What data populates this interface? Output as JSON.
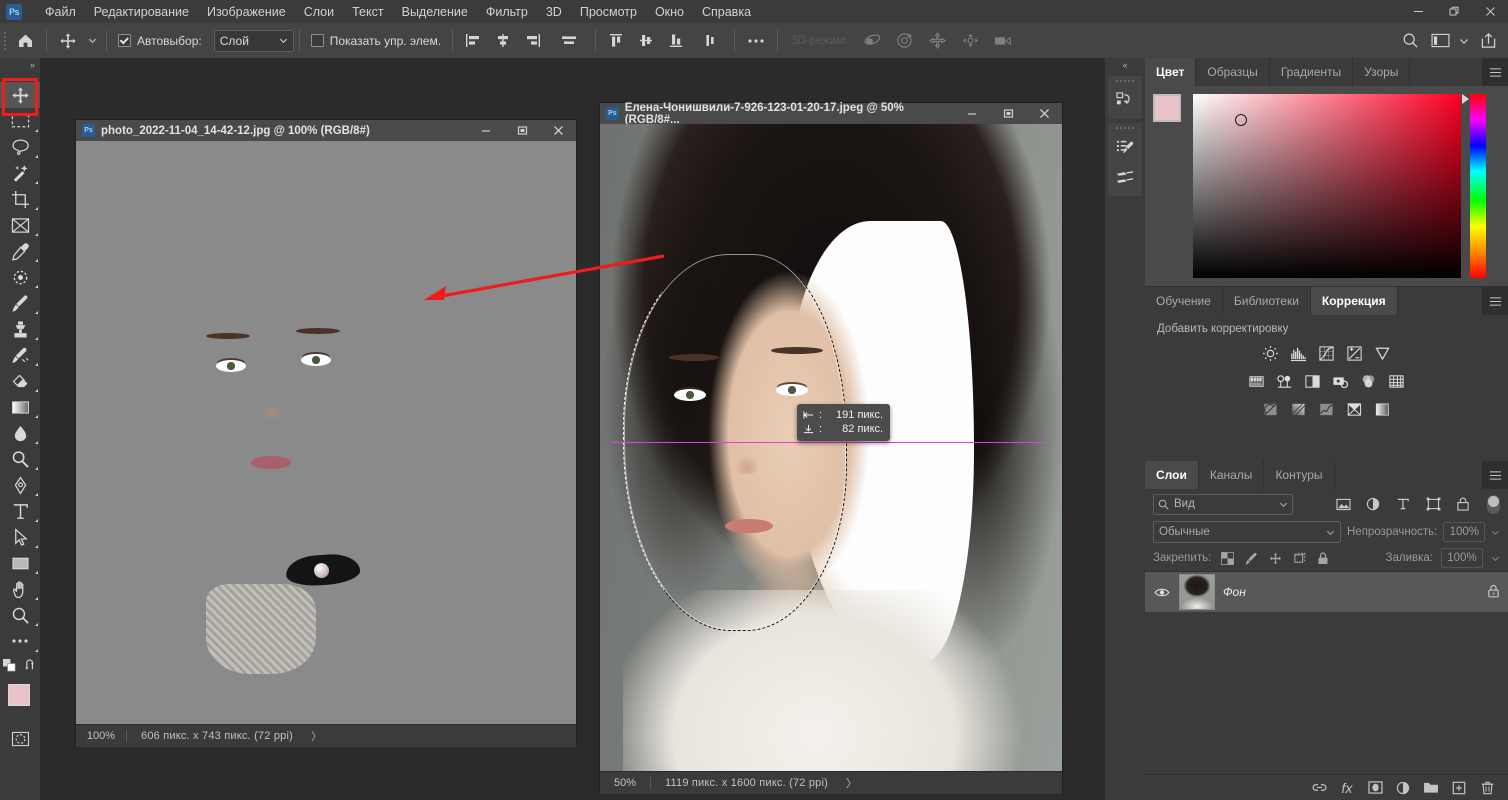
{
  "app": {
    "name": "Adobe Photoshop",
    "logo_text": "Ps",
    "window_controls": {
      "minimize": "minimize-icon",
      "restore": "restore-icon",
      "close": "close-icon"
    }
  },
  "menu": {
    "items": [
      {
        "label": "Файл"
      },
      {
        "label": "Редактирование"
      },
      {
        "label": "Изображение"
      },
      {
        "label": "Слои"
      },
      {
        "label": "Текст"
      },
      {
        "label": "Выделение"
      },
      {
        "label": "Фильтр"
      },
      {
        "label": "3D"
      },
      {
        "label": "Просмотр"
      },
      {
        "label": "Окно"
      },
      {
        "label": "Справка"
      }
    ]
  },
  "options_bar": {
    "home_icon": "home-icon",
    "tool_icon": "move-tool-icon",
    "autoselect_label": "Автовыбор:",
    "autoselect_checked": true,
    "autoselect_value": "Слой",
    "show_controls_label": "Показать упр. элем.",
    "show_controls_checked": false,
    "mode3d_label": "3D-режим:",
    "align_icons": [
      "align-left-icon",
      "align-center-horizontal-icon",
      "align-right-icon",
      "distribute-horizontal-icon"
    ],
    "align_icons2": [
      "align-top-icon",
      "align-middle-vertical-icon",
      "align-bottom-icon",
      "distribute-vertical-icon"
    ],
    "more_icon": "more-options-icon",
    "mode3d_icons": [
      "orbit-3d-icon",
      "roll-3d-icon",
      "pan-3d-icon",
      "slide-3d-icon",
      "camera-3d-icon"
    ],
    "right_icons": [
      "search-icon",
      "workspace-icon",
      "chevron-down-icon",
      "share-icon"
    ]
  },
  "toolbar": {
    "collapse_icon": "expand-toolbar-icon",
    "selected_tool": "move-tool",
    "highlight_color": "#ef1d1d",
    "tools": [
      {
        "name": "move-tool",
        "icon": "move-tool-icon",
        "selected": true
      },
      {
        "name": "rectangular-marquee-tool",
        "icon": "marquee-icon",
        "selected": false
      },
      {
        "name": "lasso-tool",
        "icon": "lasso-icon",
        "selected": false
      },
      {
        "name": "quick-selection-tool",
        "icon": "magic-wand-icon",
        "selected": false
      },
      {
        "name": "crop-tool",
        "icon": "crop-icon",
        "selected": false
      },
      {
        "name": "frame-tool",
        "icon": "frame-icon",
        "selected": false
      },
      {
        "name": "eyedropper-tool",
        "icon": "eyedropper-icon",
        "selected": false
      },
      {
        "name": "spot-healing-tool",
        "icon": "healing-brush-icon",
        "selected": false
      },
      {
        "name": "brush-tool",
        "icon": "brush-icon",
        "selected": false
      },
      {
        "name": "clone-stamp-tool",
        "icon": "clone-stamp-icon",
        "selected": false
      },
      {
        "name": "history-brush-tool",
        "icon": "history-brush-icon",
        "selected": false
      },
      {
        "name": "eraser-tool",
        "icon": "eraser-icon",
        "selected": false
      },
      {
        "name": "gradient-tool",
        "icon": "gradient-icon",
        "selected": false
      },
      {
        "name": "blur-tool",
        "icon": "blur-drop-icon",
        "selected": false
      },
      {
        "name": "dodge-tool",
        "icon": "dodge-icon",
        "selected": false
      },
      {
        "name": "pen-tool",
        "icon": "pen-icon",
        "selected": false
      },
      {
        "name": "type-tool",
        "icon": "type-icon",
        "selected": false
      },
      {
        "name": "path-selection-tool",
        "icon": "path-arrow-icon",
        "selected": false
      },
      {
        "name": "rectangle-tool",
        "icon": "rectangle-icon",
        "selected": false
      },
      {
        "name": "hand-tool",
        "icon": "hand-icon",
        "selected": false
      },
      {
        "name": "zoom-tool",
        "icon": "zoom-icon",
        "selected": false
      },
      {
        "name": "edit-toolbar",
        "icon": "ellipsis-icon",
        "selected": false
      }
    ],
    "foreground_color": "#e8c4c8",
    "background_color": "#ffffff",
    "swap_icon": "swap-colors-icon",
    "default_icon": "default-colors-icon",
    "quickmask_icon": "quick-mask-icon"
  },
  "documents": [
    {
      "title": "photo_2022-11-04_14-42-12.jpg @ 100% (RGB/8#)",
      "zoom": "100%",
      "dimensions": "606 пикс. x 743 пикс. (72 ppi)",
      "arrow": "〉",
      "controls": [
        "minimize-icon",
        "restore-icon",
        "close-icon"
      ]
    },
    {
      "title": "Елена-Чонишвили-7-926-123-01-20-17.jpeg @ 50% (RGB/8#...",
      "zoom": "50%",
      "dimensions": "1119 пикс. x 1600 пикс. (72 ppi)",
      "arrow": "〉",
      "controls": [
        "minimize-icon",
        "restore-icon",
        "close-icon"
      ]
    }
  ],
  "annotations": {
    "red_arrow_color": "#ee1c1c",
    "guide_color": "#e040e0",
    "tooltip": {
      "width_icon": "width-measure-icon",
      "width_value": "191 пикс.",
      "height_icon": "height-measure-icon",
      "height_value": "82 пикс."
    }
  },
  "panel_rail": {
    "collapse_icon": "collapse-panels-icon",
    "buttons": [
      {
        "name": "history-panel-icon"
      },
      {
        "name": "brush-settings-panel-icon"
      },
      {
        "name": "brushes-panel-icon"
      }
    ]
  },
  "color_panel": {
    "tabs": [
      {
        "label": "Цвет",
        "active": true
      },
      {
        "label": "Образцы",
        "active": false
      },
      {
        "label": "Градиенты",
        "active": false
      },
      {
        "label": "Узоры",
        "active": false
      }
    ],
    "menu_icon": "panel-menu-icon",
    "foreground_color": "#e8c4c8",
    "background_color": "#ffffff",
    "picker_hue": "#ff0022"
  },
  "adjustments_panel": {
    "tabs": [
      {
        "label": "Обучение",
        "active": false
      },
      {
        "label": "Библиотеки",
        "active": false
      },
      {
        "label": "Коррекция",
        "active": true
      }
    ],
    "menu_icon": "panel-menu-icon",
    "add_label": "Добавить корректировку",
    "row1": [
      "brightness-contrast-icon",
      "levels-icon",
      "curves-icon",
      "exposure-icon",
      "vibrance-icon"
    ],
    "row2": [
      "hue-saturation-icon",
      "color-balance-icon",
      "black-white-icon",
      "photo-filter-icon",
      "channel-mixer-icon",
      "color-lookup-icon"
    ],
    "row3": [
      "invert-icon",
      "posterize-icon",
      "threshold-icon",
      "gradient-map-icon",
      "selective-color-icon"
    ]
  },
  "layers_panel": {
    "tabs": [
      {
        "label": "Слои",
        "active": true
      },
      {
        "label": "Каналы",
        "active": false
      },
      {
        "label": "Контуры",
        "active": false
      }
    ],
    "menu_icon": "panel-menu-icon",
    "filter_placeholder": "Вид",
    "filter_icons": [
      "filter-pixel-icon",
      "filter-adjustment-icon",
      "filter-type-icon",
      "filter-shape-icon",
      "filter-smart-icon"
    ],
    "filter_toggle": "filter-enable-toggle",
    "blend_mode": "Обычные",
    "opacity_label": "Непрозрачность:",
    "opacity_value": "100%",
    "lock_label": "Закрепить:",
    "lock_icons": [
      "lock-transparent-icon",
      "lock-image-icon",
      "lock-position-icon",
      "lock-artboard-icon",
      "lock-all-icon"
    ],
    "fill_label": "Заливка:",
    "fill_value": "100%",
    "layers": [
      {
        "name": "Фон",
        "visible": true,
        "locked": true,
        "eye_icon": "eye-icon",
        "lock_icon": "lock-icon"
      }
    ],
    "bottom_icons": [
      "link-layers-icon",
      "layer-style-icon",
      "layer-mask-icon",
      "adjustment-layer-icon",
      "new-group-icon",
      "new-layer-icon",
      "delete-layer-icon"
    ],
    "fx_label": "fx"
  }
}
